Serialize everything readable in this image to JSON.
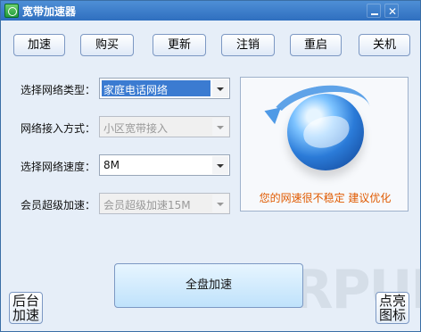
{
  "window": {
    "title": "宽带加速器",
    "minimize_symbol": "",
    "close_symbol": ""
  },
  "toolbar": {
    "buttons": [
      {
        "label": "加速"
      },
      {
        "label": "购买"
      },
      {
        "label": "更新"
      },
      {
        "label": "注销"
      },
      {
        "label": "重启"
      },
      {
        "label": "关机"
      }
    ]
  },
  "form": {
    "network_type": {
      "label": "选择网络类型：",
      "value": "家庭电话网络",
      "disabled": false,
      "selected": true
    },
    "access_mode": {
      "label": "网络接入方式：",
      "value": "小区宽带接入",
      "disabled": true
    },
    "network_speed": {
      "label": "选择网络速度：",
      "value": "8M",
      "disabled": false
    },
    "member_speedup": {
      "label": "会员超级加速：",
      "value": "会员超级加速15M",
      "disabled": true
    }
  },
  "promo": {
    "message": "您的网速很不稳定 建议优化",
    "message_color": "#e05a00"
  },
  "actions": {
    "full_speedup_label": "全盘加速",
    "background_label_line1": "后台",
    "background_label_line2": "加速",
    "tray_label_line1": "点亮",
    "tray_label_line2": "图标"
  },
  "watermark": {
    "text": "ARPUN"
  }
}
